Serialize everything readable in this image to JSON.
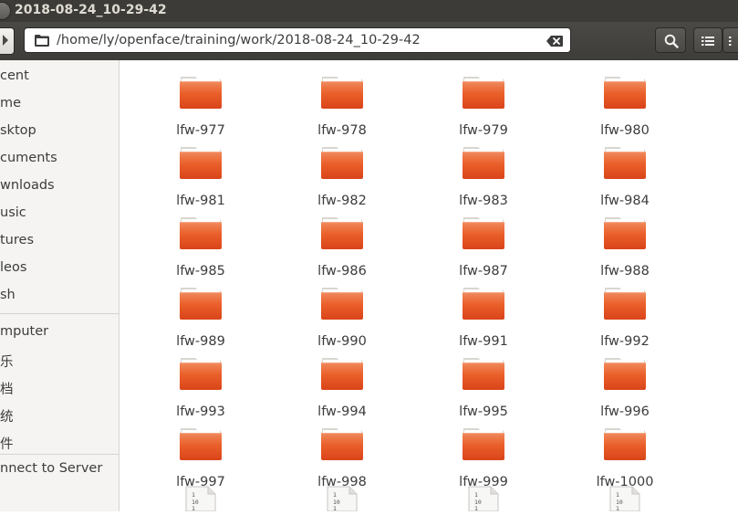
{
  "window": {
    "title": "2018-08-24_10-29-42"
  },
  "pathbar": {
    "path": "/home/ly/openface/training/work/2018-08-24_10-29-42"
  },
  "sidebar": {
    "items": [
      {
        "label": "cent"
      },
      {
        "label": "me"
      },
      {
        "label": "sktop"
      },
      {
        "label": "cuments"
      },
      {
        "label": "wnloads"
      },
      {
        "label": "usic"
      },
      {
        "label": "tures"
      },
      {
        "label": "leos"
      },
      {
        "label": "sh"
      },
      {
        "label": "mputer"
      },
      {
        "label": "乐"
      },
      {
        "label": "档"
      },
      {
        "label": "统"
      },
      {
        "label": "件"
      },
      {
        "label": "nnect to Server"
      }
    ]
  },
  "folders": [
    {
      "name": "lfw-977"
    },
    {
      "name": "lfw-978"
    },
    {
      "name": "lfw-979"
    },
    {
      "name": "lfw-980"
    },
    {
      "name": "lfw-981"
    },
    {
      "name": "lfw-982"
    },
    {
      "name": "lfw-983"
    },
    {
      "name": "lfw-984"
    },
    {
      "name": "lfw-985"
    },
    {
      "name": "lfw-986"
    },
    {
      "name": "lfw-987"
    },
    {
      "name": "lfw-988"
    },
    {
      "name": "lfw-989"
    },
    {
      "name": "lfw-990"
    },
    {
      "name": "lfw-991"
    },
    {
      "name": "lfw-992"
    },
    {
      "name": "lfw-993"
    },
    {
      "name": "lfw-994"
    },
    {
      "name": "lfw-995"
    },
    {
      "name": "lfw-996"
    },
    {
      "name": "lfw-997"
    },
    {
      "name": "lfw-998"
    },
    {
      "name": "lfw-999"
    },
    {
      "name": "lfw-1000"
    }
  ],
  "files": [
    {
      "icon": "binary-file-icon"
    },
    {
      "icon": "binary-file-icon"
    },
    {
      "icon": "binary-file-icon"
    },
    {
      "icon": "binary-file-icon"
    }
  ],
  "icons": {
    "folder": "folder-icon",
    "search": "search-icon",
    "list_view": "list-view-icon",
    "clear": "clear-text-icon"
  },
  "colors": {
    "folder_orange": "#e95420",
    "titlebar": "#3c3b37",
    "sidebar_bg": "#f5f4f2"
  }
}
